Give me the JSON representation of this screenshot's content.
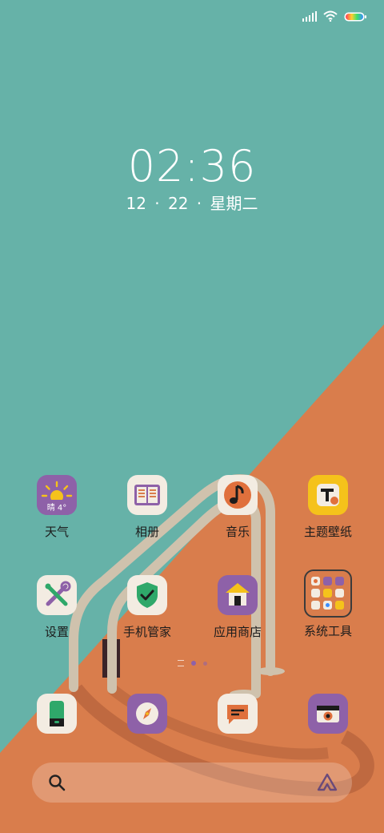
{
  "status_bar": {
    "signal_icon": "signal-icon",
    "wifi_icon": "wifi-icon",
    "battery_icon": "battery-icon"
  },
  "lockclock": {
    "time": "02:36",
    "date": "12 · 22 ·  星期二"
  },
  "apps": [
    {
      "label": "天气",
      "icon": "weather-icon",
      "icon_text": "晴 4°"
    },
    {
      "label": "相册",
      "icon": "gallery-icon"
    },
    {
      "label": "音乐",
      "icon": "music-icon"
    },
    {
      "label": "主题壁纸",
      "icon": "theme-icon"
    },
    {
      "label": "设置",
      "icon": "settings-icon"
    },
    {
      "label": "手机管家",
      "icon": "security-icon"
    },
    {
      "label": "应用商店",
      "icon": "app-store-icon"
    },
    {
      "label": "系统工具",
      "icon": "folder-icon"
    }
  ],
  "dock": [
    {
      "icon": "phone-icon"
    },
    {
      "icon": "browser-icon"
    },
    {
      "icon": "messages-icon"
    },
    {
      "icon": "camera-icon"
    }
  ],
  "page_indicator": {
    "pages": 3,
    "current": 2
  },
  "search": {
    "search_icon": "search-icon",
    "assistant_icon": "assistant-icon"
  },
  "colors": {
    "teal": "#66b2a8",
    "orange": "#d97d4c",
    "purple": "#8e61a8",
    "yellow": "#f5c21b",
    "off_white": "#f3ece2"
  }
}
